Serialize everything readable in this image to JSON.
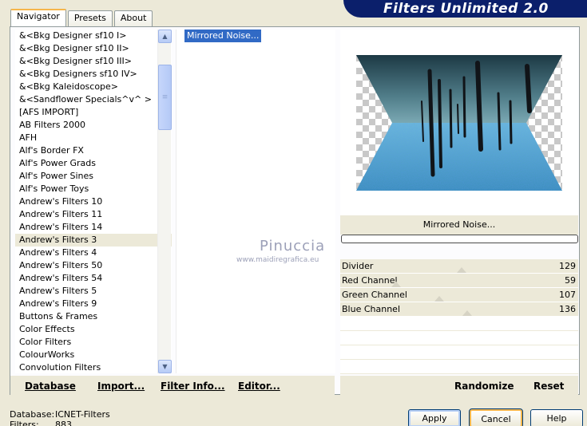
{
  "window": {
    "title": "Filters Unlimited 2.0"
  },
  "tabs": [
    {
      "label": "Navigator",
      "active": true
    },
    {
      "label": "Presets",
      "active": false
    },
    {
      "label": "About",
      "active": false
    }
  ],
  "categories": {
    "items": [
      "&<Bkg Designer sf10 I>",
      "&<Bkg Designer sf10 II>",
      "&<Bkg Designer sf10 III>",
      "&<Bkg Designers sf10 IV>",
      "&<Bkg Kaleidoscope>",
      "&<Sandflower Specials^v^ >",
      "[AFS IMPORT]",
      "AB Filters 2000",
      "AFH",
      "Alf's Border FX",
      "Alf's Power Grads",
      "Alf's Power Sines",
      "Alf's Power Toys",
      "Andrew's Filters 10",
      "Andrew's Filters 11",
      "Andrew's Filters 14",
      "Andrew's Filters 3",
      "Andrew's Filters 4",
      "Andrew's Filters 50",
      "Andrew's Filters 54",
      "Andrew's Filters 5",
      "Andrew's Filters 9",
      "Buttons & Frames",
      "Color Effects",
      "Color Filters",
      "ColourWorks",
      "Convolution Filters"
    ],
    "selected": "Andrew's Filters 3"
  },
  "filters": {
    "items": [
      "Mirrored Noise..."
    ],
    "selected": "Mirrored Noise..."
  },
  "watermark": {
    "name": "Pinuccia",
    "url": "www.maidiregrafica.eu"
  },
  "preview": {
    "filter_name": "Mirrored Noise...",
    "progress": 0
  },
  "parameters": [
    {
      "label": "Divider",
      "value": 129
    },
    {
      "label": "Red Channel",
      "value": 59
    },
    {
      "label": "Green Channel",
      "value": 107
    },
    {
      "label": "Blue Channel",
      "value": 136
    }
  ],
  "toolbar": {
    "database": "Database",
    "import": "Import...",
    "filter_info": "Filter Info...",
    "editor": "Editor...",
    "randomize": "Randomize",
    "reset": "Reset"
  },
  "status": {
    "database_label": "Database:",
    "database_value": "ICNET-Filters",
    "filters_label": "Filters:",
    "filters_value": "883"
  },
  "buttons": {
    "apply": "Apply",
    "cancel": "Cancel",
    "help": "Help"
  },
  "colors": {
    "banner": "#0b1f6b",
    "selection": "#316ac5",
    "window_bg": "#ece9d8"
  }
}
